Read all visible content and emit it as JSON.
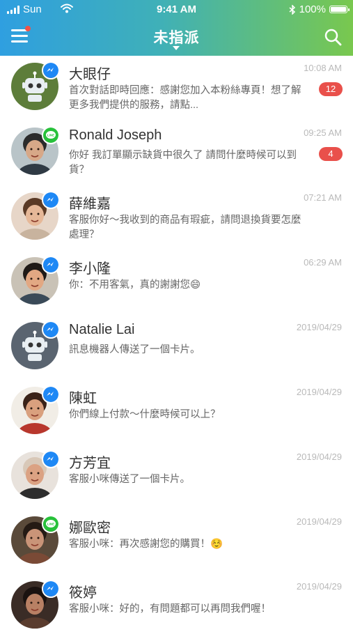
{
  "status": {
    "carrier": "Sun",
    "time": "9:41 AM",
    "battery": "100%"
  },
  "nav": {
    "title": "未指派"
  },
  "conversations": [
    {
      "name": "大眼仔",
      "time": "10:08 AM",
      "preview": "首次對話即時回應：感謝您加入本粉絲專頁！想了解更多我們提供的服務，請點...",
      "unread": "12",
      "channel": "messenger",
      "avatar": "robot-green"
    },
    {
      "name": "Ronald Joseph",
      "time": "09:25 AM",
      "preview": "你好 我訂單顯示缺貨中很久了 請問什麼時候可以到貨？",
      "unread": "4",
      "channel": "line",
      "avatar": "person-man-suit"
    },
    {
      "name": "薛維嘉",
      "time": "07:21 AM",
      "preview": "客服你好～我收到的商品有瑕疵，請問退換貨要怎麼處理？",
      "unread": "",
      "channel": "messenger",
      "avatar": "person-woman-phone"
    },
    {
      "name": "李小隆",
      "time": "06:29 AM",
      "preview": "你：不用客氣，真的謝謝您😄",
      "unread": "",
      "channel": "messenger",
      "avatar": "person-man-smile"
    },
    {
      "name": "Natalie Lai",
      "time": "2019/04/29",
      "preview": "訊息機器人傳送了一個卡片。",
      "unread": "",
      "channel": "messenger",
      "avatar": "robot-gray"
    },
    {
      "name": "陳虹",
      "time": "2019/04/29",
      "preview": "你們線上付款～什麼時候可以上？",
      "unread": "",
      "channel": "messenger",
      "avatar": "person-woman-glasses"
    },
    {
      "name": "方芳宜",
      "time": "2019/04/29",
      "preview": "客服小咪傳送了一個卡片。",
      "unread": "",
      "channel": "messenger",
      "avatar": "person-woman-blonde"
    },
    {
      "name": "娜歐密",
      "time": "2019/04/29",
      "preview": "客服小咪：再次感謝您的購買！☺️",
      "unread": "",
      "channel": "line",
      "avatar": "person-woman-curly"
    },
    {
      "name": "筱婷",
      "time": "2019/04/29",
      "preview": "客服小咪：好的，有問題都可以再問我們喔！",
      "unread": "",
      "channel": "messenger",
      "avatar": "person-woman-phone-dark"
    }
  ],
  "colors": {
    "messenger": "#1e88f5",
    "line": "#27c13a",
    "unread_badge": "#e9504b"
  }
}
